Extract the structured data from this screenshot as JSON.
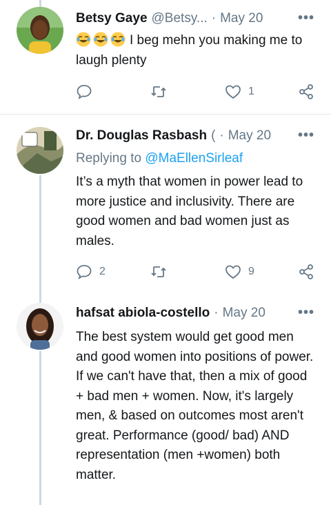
{
  "tweets": [
    {
      "name": "Betsy Gaye",
      "handle": "@Betsy...",
      "separator": "·",
      "date": "May 20",
      "emoji_count": 3,
      "text": "I beg mehn you making me to laugh plenty",
      "counts": {
        "reply": "",
        "retweet": "",
        "like": "1"
      }
    },
    {
      "name": "Dr. Douglas Rasbash",
      "handle": "(",
      "separator": "·",
      "date": "May 20",
      "replying_prefix": "Replying to",
      "replying_handle": "@MaEllenSirleaf",
      "text": "It’s a myth that women in power lead to more justice and inclusivity. There are good women and bad women just as males.",
      "counts": {
        "reply": "2",
        "retweet": "",
        "like": "9"
      }
    },
    {
      "name": "hafsat abiola-costello",
      "separator": "·",
      "date": "May 20",
      "text": "The best system would get good men and good women into positions of power. If we can't have that, then a mix of good + bad men + women. Now, it's largely men, & based on outcomes most aren't great. Performance (good/ bad) AND representation (men +women) both matter."
    }
  ],
  "more_glyph": "•••",
  "icons": [
    "reply-icon",
    "retweet-icon",
    "like-icon",
    "share-icon",
    "more-icon",
    "emoji-laugh-icon"
  ],
  "colors": {
    "accent": "#1da1f2",
    "muted": "#657786",
    "divider": "#e1e8ed",
    "thread": "#cfd9de"
  }
}
